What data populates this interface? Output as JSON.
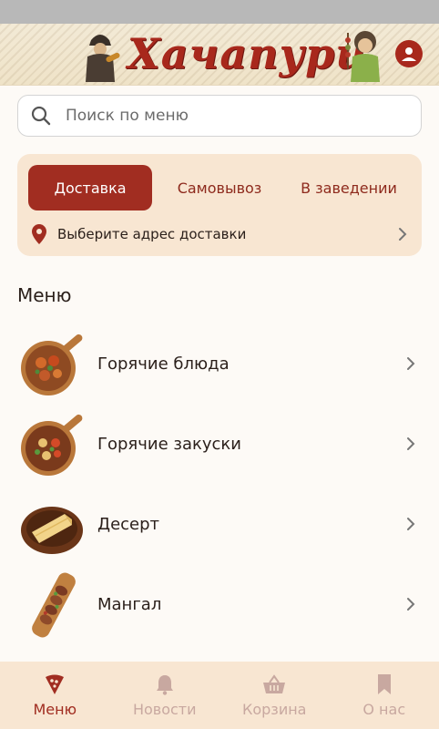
{
  "header": {
    "logo_text": "Хачапури",
    "profile_icon": "user-circle-icon"
  },
  "search": {
    "placeholder": "Поиск по меню",
    "value": ""
  },
  "delivery": {
    "tabs": [
      {
        "label": "Доставка",
        "active": true
      },
      {
        "label": "Самовывоз",
        "active": false
      },
      {
        "label": "В заведении",
        "active": false
      }
    ],
    "address_prompt": "Выберите адрес доставки"
  },
  "menu": {
    "title": "Меню",
    "items": [
      {
        "label": "Горячие блюда",
        "icon": "hot-dish-thumb"
      },
      {
        "label": "Горячие закуски",
        "icon": "hot-appetizer-thumb"
      },
      {
        "label": "Десерт",
        "icon": "dessert-thumb"
      },
      {
        "label": "Мангал",
        "icon": "grill-thumb"
      }
    ]
  },
  "nav": {
    "items": [
      {
        "label": "Меню",
        "icon": "pizza-slice-icon",
        "active": true
      },
      {
        "label": "Новости",
        "icon": "bell-icon",
        "active": false
      },
      {
        "label": "Корзина",
        "icon": "basket-icon",
        "active": false
      },
      {
        "label": "О нас",
        "icon": "bookmark-icon",
        "active": false
      }
    ]
  },
  "colors": {
    "accent": "#a12d21",
    "card_bg": "#f8e6d2",
    "nav_inactive": "#c8a8a0"
  }
}
